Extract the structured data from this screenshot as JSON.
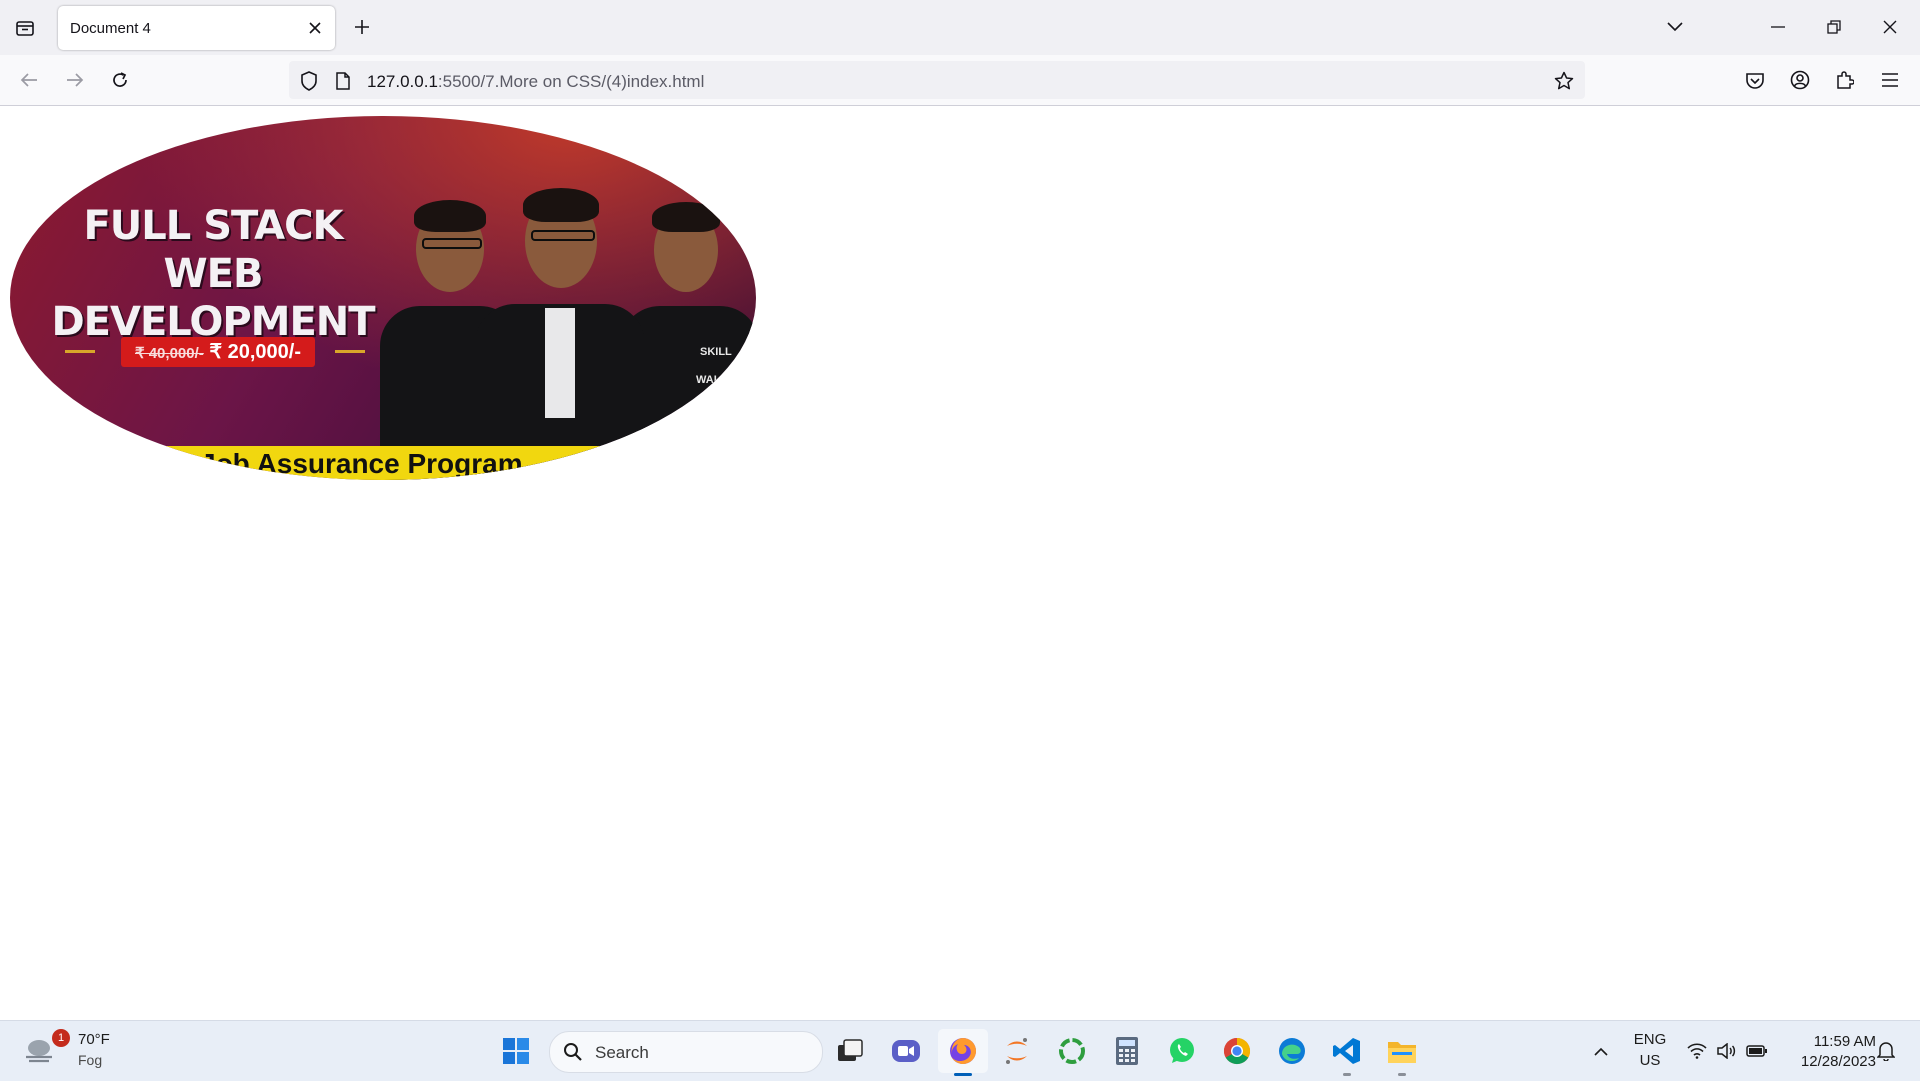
{
  "browser": {
    "tab": {
      "title": "Document 4"
    },
    "url": {
      "host": "127.0.0.1",
      "path": ":5500/7.More on CSS/(4)index.html"
    }
  },
  "banner": {
    "title_line1": "FULL STACK",
    "title_line2": "WEB DEVELOPMENT",
    "price_old": "₹ 40,000/-",
    "price_new": "₹ 20,000/-",
    "program": "Job Assurance Program",
    "logo_text": "SKILL",
    "logo_text2": "WALLAH"
  },
  "taskbar": {
    "weather": {
      "temp": "70°F",
      "condition": "Fog",
      "badge": "1"
    },
    "search_placeholder": "Search",
    "language": {
      "line1": "ENG",
      "line2": "US"
    },
    "clock": {
      "time": "11:59 AM",
      "date": "12/28/2023"
    }
  },
  "colors": {
    "accent_yellow": "#f1d70f",
    "price_red": "#d41b1b",
    "taskbar_bg": "#e8eef7"
  }
}
